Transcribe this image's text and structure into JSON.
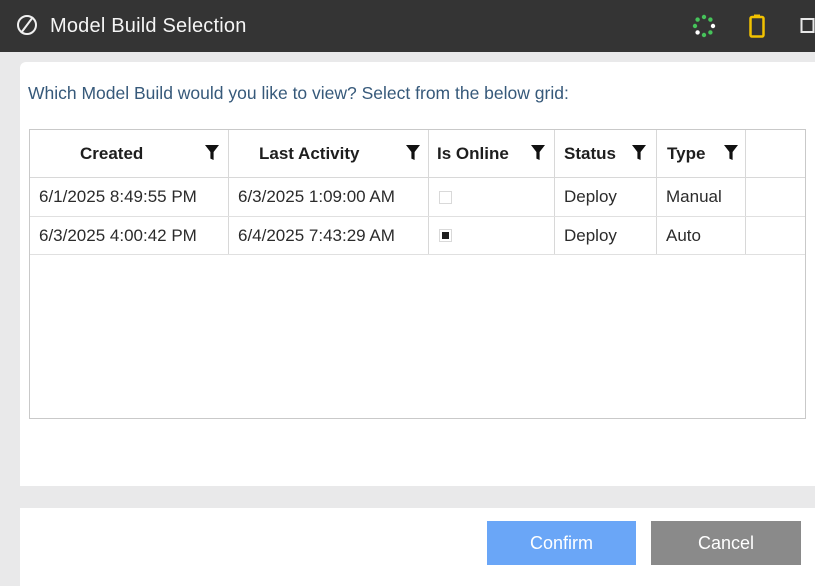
{
  "window": {
    "title": "Model Build Selection",
    "icons": [
      "brand-logo-icon",
      "loading-spinner-icon",
      "battery-icon",
      "window-restore-icon"
    ]
  },
  "prompt": "Which Model Build would you like to view? Select from the below grid:",
  "grid": {
    "columns": [
      "Created",
      "Last Activity",
      "Is Online",
      "Status",
      "Type"
    ],
    "rows": [
      {
        "created": "6/1/2025 8:49:55 PM",
        "last_activity": "6/3/2025 1:09:00 AM",
        "is_online": false,
        "status": "Deploy",
        "type": "Manual"
      },
      {
        "created": "6/3/2025 4:00:42 PM",
        "last_activity": "6/4/2025 7:43:29 AM",
        "is_online": true,
        "status": "Deploy",
        "type": "Auto"
      }
    ]
  },
  "buttons": {
    "confirm": "Confirm",
    "cancel": "Cancel"
  },
  "colors": {
    "titlebar": "#343434",
    "prompt_text": "#36597a",
    "confirm": "#6aa6f7",
    "cancel": "#8a8a8a",
    "spinner": "#46c35a",
    "battery": "#f2c200"
  }
}
